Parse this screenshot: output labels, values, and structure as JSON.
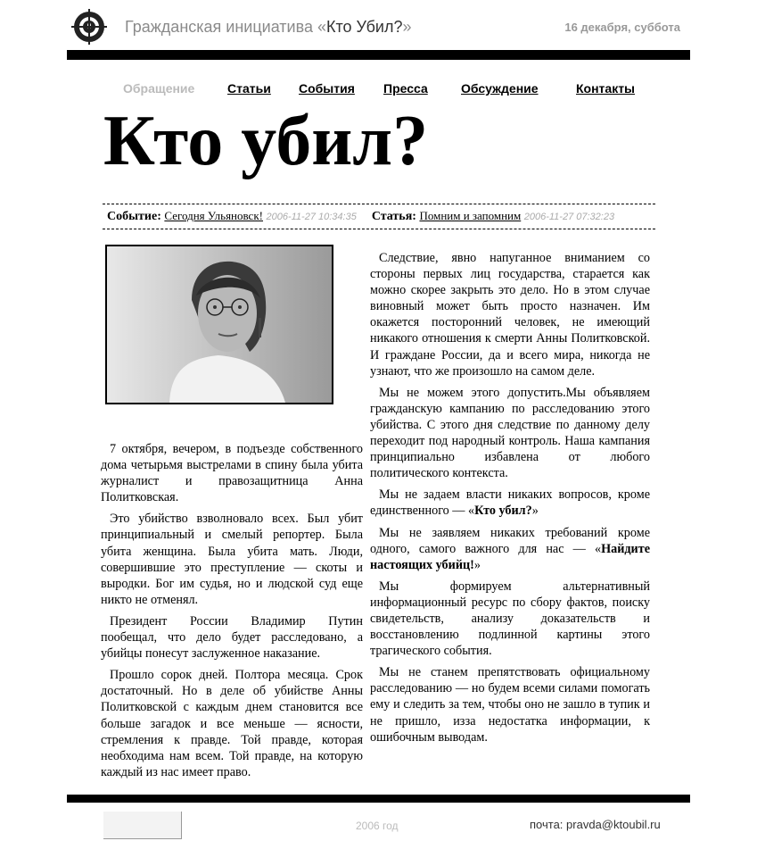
{
  "header": {
    "logo_icon": "crosshair-globe-icon",
    "site_title_prefix": "Гражданская инициатива «",
    "site_title_name": "Кто Убил?",
    "site_title_suffix": "»",
    "date": "16 декабря, суббота"
  },
  "nav": [
    {
      "label": "Обращение",
      "active": true
    },
    {
      "label": "Статьи",
      "active": false
    },
    {
      "label": "События",
      "active": false
    },
    {
      "label": "Пресса",
      "active": false
    },
    {
      "label": "Обсуждение",
      "active": false
    },
    {
      "label": "Контакты",
      "active": false
    }
  ],
  "headline": "Кто убил?",
  "latest": {
    "event_label": "Событие:",
    "event_link": "Сегодня Ульяновск!",
    "event_time": "2006-11-27 10:34:35",
    "article_label": "Статья:",
    "article_link": "Помним и запомним",
    "article_time": "2006-11-27 07:32:23"
  },
  "photo_icon": "portrait-photo",
  "left_column": [
    "7 октября, вечером, в подъезде собственного дома  четырьмя выстрелами в спину была убита журналист и правозащитница Анна Политковская.",
    "Это убийство взволновало всех. Был убит принципиальный и смелый репортер. Была убита женщина.  Была убита мать. Люди, совершившие это преступление — скоты и выродки. Бог им судья, но и людской суд еще никто не отменял.",
    "Президент России Владимир Путин пообещал,  что  дело будет расследовано, а убийцы  понесут заслуженное наказание.",
    "Прошло сорок дней.  Полтора месяца. Срок достаточный.  Но в деле об убийстве Анны Политковской с каждым днем становится все больше загадок и все меньше — ясности, стремления к правде. Той правде, которая необходима нам всем. Той правде, на которую каждый из нас имеет право."
  ],
  "right_column": {
    "p1": "Следствие, явно напуганное вниманием со стороны  первых  лиц государства, старается  как  можно скорее закрыть  это дело.  Но в этом случае виновный может быть просто назначен. Им окажется посторонний человек, не имеющий  никакого  отношения  к  смерти Анны Политковской. И граждане  России,  да и всего мира, никогда не узнают, что же произошло на самом деле.",
    "p2": "Мы  не  можем  этого  допустить.Мы объявляем  гражданскую  кампанию  по  расследованию этого убийства. С этого дня следствие по данному делу переходит под народный контроль. Наша кампания принципиально избавлена  от любого  политического контекста.",
    "p3_before": "Мы   не   задаем власти никаких вопросов, кроме единственного — «",
    "p3_bold": "Кто убил?",
    "p3_after": "»",
    "p4_before": "Мы не заявляем никаких требований  кроме одного, самого важного для нас — «",
    "p4_bold": "Найдите настоящих убийц!",
    "p4_after": "»",
    "p5": "Мы формируем  альтернативный  информационный  ресурс  по  сбору фактов,  поиску свидетельств,  анализу доказательств  и  восстановлению  подлинной картины этого трагического события.",
    "p6": "Мы  не  станем  препятствовать  официальному  расследованию  —  но будем  всеми силами  помогать  ему  и   следить  за тем, чтобы  оно  не зашло в тупик и не пришло, изза недостатка  информации, к ошибочным  выводам."
  },
  "footer": {
    "year": "2006 год",
    "email_label": "почта:",
    "email": "pravda@ktoubil.ru"
  }
}
